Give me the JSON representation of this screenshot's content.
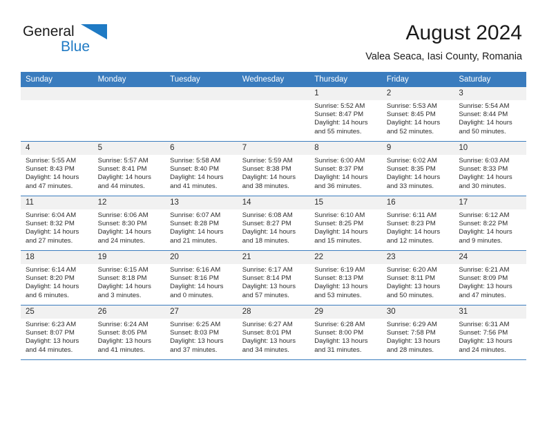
{
  "brand": {
    "name_part1": "General",
    "name_part2": "Blue",
    "triangle_icon": "brand-triangle-icon",
    "accent_color": "#1f7ac4"
  },
  "header": {
    "title": "August 2024",
    "subtitle": "Valea Seaca, Iasi County, Romania"
  },
  "theme": {
    "header_row_bg": "#3a7cbe",
    "daynum_bg": "#f1f1f1",
    "grid_line": "#3a7cbe",
    "text": "#2b2b2b"
  },
  "weekday_headers": [
    "Sunday",
    "Monday",
    "Tuesday",
    "Wednesday",
    "Thursday",
    "Friday",
    "Saturday"
  ],
  "weeks": [
    [
      {
        "day": "",
        "blank": true
      },
      {
        "day": "",
        "blank": true
      },
      {
        "day": "",
        "blank": true
      },
      {
        "day": "",
        "blank": true
      },
      {
        "day": "1",
        "sunrise": "Sunrise: 5:52 AM",
        "sunset": "Sunset: 8:47 PM",
        "daylight_line1": "Daylight: 14 hours",
        "daylight_line2": "and 55 minutes."
      },
      {
        "day": "2",
        "sunrise": "Sunrise: 5:53 AM",
        "sunset": "Sunset: 8:45 PM",
        "daylight_line1": "Daylight: 14 hours",
        "daylight_line2": "and 52 minutes."
      },
      {
        "day": "3",
        "sunrise": "Sunrise: 5:54 AM",
        "sunset": "Sunset: 8:44 PM",
        "daylight_line1": "Daylight: 14 hours",
        "daylight_line2": "and 50 minutes."
      }
    ],
    [
      {
        "day": "4",
        "sunrise": "Sunrise: 5:55 AM",
        "sunset": "Sunset: 8:43 PM",
        "daylight_line1": "Daylight: 14 hours",
        "daylight_line2": "and 47 minutes."
      },
      {
        "day": "5",
        "sunrise": "Sunrise: 5:57 AM",
        "sunset": "Sunset: 8:41 PM",
        "daylight_line1": "Daylight: 14 hours",
        "daylight_line2": "and 44 minutes."
      },
      {
        "day": "6",
        "sunrise": "Sunrise: 5:58 AM",
        "sunset": "Sunset: 8:40 PM",
        "daylight_line1": "Daylight: 14 hours",
        "daylight_line2": "and 41 minutes."
      },
      {
        "day": "7",
        "sunrise": "Sunrise: 5:59 AM",
        "sunset": "Sunset: 8:38 PM",
        "daylight_line1": "Daylight: 14 hours",
        "daylight_line2": "and 38 minutes."
      },
      {
        "day": "8",
        "sunrise": "Sunrise: 6:00 AM",
        "sunset": "Sunset: 8:37 PM",
        "daylight_line1": "Daylight: 14 hours",
        "daylight_line2": "and 36 minutes."
      },
      {
        "day": "9",
        "sunrise": "Sunrise: 6:02 AM",
        "sunset": "Sunset: 8:35 PM",
        "daylight_line1": "Daylight: 14 hours",
        "daylight_line2": "and 33 minutes."
      },
      {
        "day": "10",
        "sunrise": "Sunrise: 6:03 AM",
        "sunset": "Sunset: 8:33 PM",
        "daylight_line1": "Daylight: 14 hours",
        "daylight_line2": "and 30 minutes."
      }
    ],
    [
      {
        "day": "11",
        "sunrise": "Sunrise: 6:04 AM",
        "sunset": "Sunset: 8:32 PM",
        "daylight_line1": "Daylight: 14 hours",
        "daylight_line2": "and 27 minutes."
      },
      {
        "day": "12",
        "sunrise": "Sunrise: 6:06 AM",
        "sunset": "Sunset: 8:30 PM",
        "daylight_line1": "Daylight: 14 hours",
        "daylight_line2": "and 24 minutes."
      },
      {
        "day": "13",
        "sunrise": "Sunrise: 6:07 AM",
        "sunset": "Sunset: 8:28 PM",
        "daylight_line1": "Daylight: 14 hours",
        "daylight_line2": "and 21 minutes."
      },
      {
        "day": "14",
        "sunrise": "Sunrise: 6:08 AM",
        "sunset": "Sunset: 8:27 PM",
        "daylight_line1": "Daylight: 14 hours",
        "daylight_line2": "and 18 minutes."
      },
      {
        "day": "15",
        "sunrise": "Sunrise: 6:10 AM",
        "sunset": "Sunset: 8:25 PM",
        "daylight_line1": "Daylight: 14 hours",
        "daylight_line2": "and 15 minutes."
      },
      {
        "day": "16",
        "sunrise": "Sunrise: 6:11 AM",
        "sunset": "Sunset: 8:23 PM",
        "daylight_line1": "Daylight: 14 hours",
        "daylight_line2": "and 12 minutes."
      },
      {
        "day": "17",
        "sunrise": "Sunrise: 6:12 AM",
        "sunset": "Sunset: 8:22 PM",
        "daylight_line1": "Daylight: 14 hours",
        "daylight_line2": "and 9 minutes."
      }
    ],
    [
      {
        "day": "18",
        "sunrise": "Sunrise: 6:14 AM",
        "sunset": "Sunset: 8:20 PM",
        "daylight_line1": "Daylight: 14 hours",
        "daylight_line2": "and 6 minutes."
      },
      {
        "day": "19",
        "sunrise": "Sunrise: 6:15 AM",
        "sunset": "Sunset: 8:18 PM",
        "daylight_line1": "Daylight: 14 hours",
        "daylight_line2": "and 3 minutes."
      },
      {
        "day": "20",
        "sunrise": "Sunrise: 6:16 AM",
        "sunset": "Sunset: 8:16 PM",
        "daylight_line1": "Daylight: 14 hours",
        "daylight_line2": "and 0 minutes."
      },
      {
        "day": "21",
        "sunrise": "Sunrise: 6:17 AM",
        "sunset": "Sunset: 8:14 PM",
        "daylight_line1": "Daylight: 13 hours",
        "daylight_line2": "and 57 minutes."
      },
      {
        "day": "22",
        "sunrise": "Sunrise: 6:19 AM",
        "sunset": "Sunset: 8:13 PM",
        "daylight_line1": "Daylight: 13 hours",
        "daylight_line2": "and 53 minutes."
      },
      {
        "day": "23",
        "sunrise": "Sunrise: 6:20 AM",
        "sunset": "Sunset: 8:11 PM",
        "daylight_line1": "Daylight: 13 hours",
        "daylight_line2": "and 50 minutes."
      },
      {
        "day": "24",
        "sunrise": "Sunrise: 6:21 AM",
        "sunset": "Sunset: 8:09 PM",
        "daylight_line1": "Daylight: 13 hours",
        "daylight_line2": "and 47 minutes."
      }
    ],
    [
      {
        "day": "25",
        "sunrise": "Sunrise: 6:23 AM",
        "sunset": "Sunset: 8:07 PM",
        "daylight_line1": "Daylight: 13 hours",
        "daylight_line2": "and 44 minutes."
      },
      {
        "day": "26",
        "sunrise": "Sunrise: 6:24 AM",
        "sunset": "Sunset: 8:05 PM",
        "daylight_line1": "Daylight: 13 hours",
        "daylight_line2": "and 41 minutes."
      },
      {
        "day": "27",
        "sunrise": "Sunrise: 6:25 AM",
        "sunset": "Sunset: 8:03 PM",
        "daylight_line1": "Daylight: 13 hours",
        "daylight_line2": "and 37 minutes."
      },
      {
        "day": "28",
        "sunrise": "Sunrise: 6:27 AM",
        "sunset": "Sunset: 8:01 PM",
        "daylight_line1": "Daylight: 13 hours",
        "daylight_line2": "and 34 minutes."
      },
      {
        "day": "29",
        "sunrise": "Sunrise: 6:28 AM",
        "sunset": "Sunset: 8:00 PM",
        "daylight_line1": "Daylight: 13 hours",
        "daylight_line2": "and 31 minutes."
      },
      {
        "day": "30",
        "sunrise": "Sunrise: 6:29 AM",
        "sunset": "Sunset: 7:58 PM",
        "daylight_line1": "Daylight: 13 hours",
        "daylight_line2": "and 28 minutes."
      },
      {
        "day": "31",
        "sunrise": "Sunrise: 6:31 AM",
        "sunset": "Sunset: 7:56 PM",
        "daylight_line1": "Daylight: 13 hours",
        "daylight_line2": "and 24 minutes."
      }
    ]
  ]
}
